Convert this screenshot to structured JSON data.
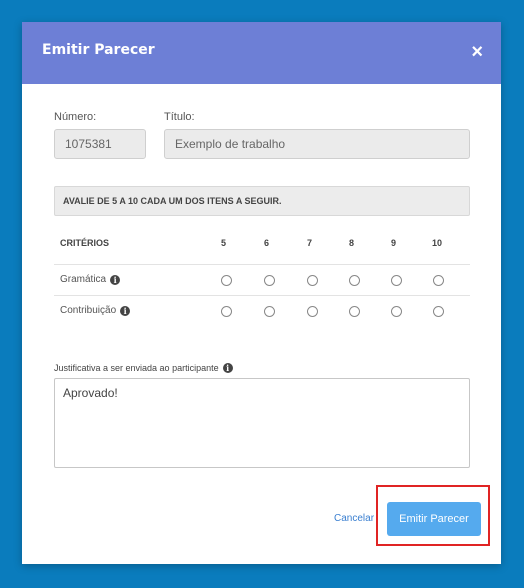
{
  "modal": {
    "title": "Emitir Parecer",
    "close_symbol": "×"
  },
  "form": {
    "numero_label": "Número:",
    "numero_value": "1075381",
    "titulo_label": "Título:",
    "titulo_value": "Exemplo de trabalho",
    "instructions": "AVALIE DE 5 A 10 CADA UM DOS ITENS A SEGUIR.",
    "criteria_header": "CRITÉRIOS",
    "scores": [
      "5",
      "6",
      "7",
      "8",
      "9",
      "10"
    ],
    "criteria": [
      {
        "label": "Gramática",
        "selected": null
      },
      {
        "label": "Contribuição",
        "selected": null
      }
    ],
    "justificativa_label": "Justificativa a ser enviada ao participante",
    "justificativa_value": "Aprovado!"
  },
  "actions": {
    "cancel_label": "Cancelar",
    "submit_label": "Emitir Parecer"
  },
  "icons": {
    "info": "info-icon",
    "close": "close-icon"
  },
  "colors": {
    "background": "#0a7cbd",
    "header": "#6d7fd6",
    "submit": "#55aaee",
    "highlight": "#e02424"
  }
}
